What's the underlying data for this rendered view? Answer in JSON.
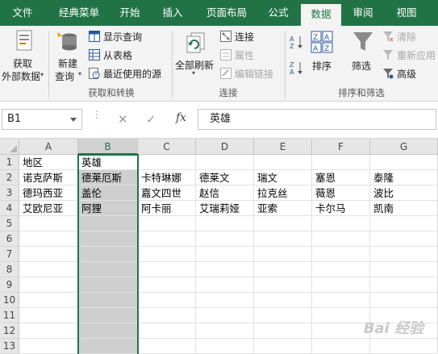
{
  "tabs": [
    {
      "label": "文件"
    },
    {
      "label": "经典菜单"
    },
    {
      "label": "开始"
    },
    {
      "label": "插入"
    },
    {
      "label": "页面布局"
    },
    {
      "label": "公式"
    },
    {
      "label": "数据",
      "active": true
    },
    {
      "label": "审阅"
    },
    {
      "label": "视图"
    }
  ],
  "ribbon": {
    "get_external_data": {
      "line1": "获取",
      "line2": "外部数据"
    },
    "new_query": {
      "line1": "新建",
      "line2": "查询"
    },
    "show_queries": "显示查询",
    "from_table": "从表格",
    "recent_sources": "最近使用的源",
    "refresh_all": "全部刷新",
    "connections": "连接",
    "properties": "属性",
    "edit_links": "编辑链接",
    "sort": "排序",
    "filter": "筛选",
    "clear": "清除",
    "reapply": "重新应用",
    "advanced": "高级",
    "groups": {
      "get_transform": "获取和转换",
      "connections": "连接",
      "sort_filter": "排序和筛选"
    }
  },
  "formula_bar": {
    "name_box": "B1",
    "fx": "fx",
    "cancel": "✕",
    "enter": "✓",
    "value": "英雄"
  },
  "columns": [
    "A",
    "B",
    "C",
    "D",
    "E",
    "F",
    "G"
  ],
  "rows": [
    "1",
    "2",
    "3",
    "4",
    "5",
    "6",
    "7",
    "8",
    "9",
    "10",
    "11",
    "12",
    "13"
  ],
  "cells": [
    [
      "地区",
      "英雄",
      "",
      "",
      "",
      "",
      ""
    ],
    [
      "诺克萨斯",
      "德莱厄斯",
      "卡特琳娜",
      "德莱文",
      "瑞文",
      "塞恩",
      "泰隆"
    ],
    [
      "德玛西亚",
      "盖伦",
      "嘉文四世",
      "赵信",
      "拉克丝",
      "薇恩",
      "波比"
    ],
    [
      "艾欧尼亚",
      "阿狸",
      "阿卡丽",
      "艾瑞莉娅",
      "亚索",
      "卡尔马",
      "凯南"
    ]
  ],
  "selection": {
    "column": "B",
    "active_cell": "B1"
  },
  "colors": {
    "accent": "#217346",
    "selection_fill": "#cfcfcf"
  },
  "watermark": "Bai 经验"
}
